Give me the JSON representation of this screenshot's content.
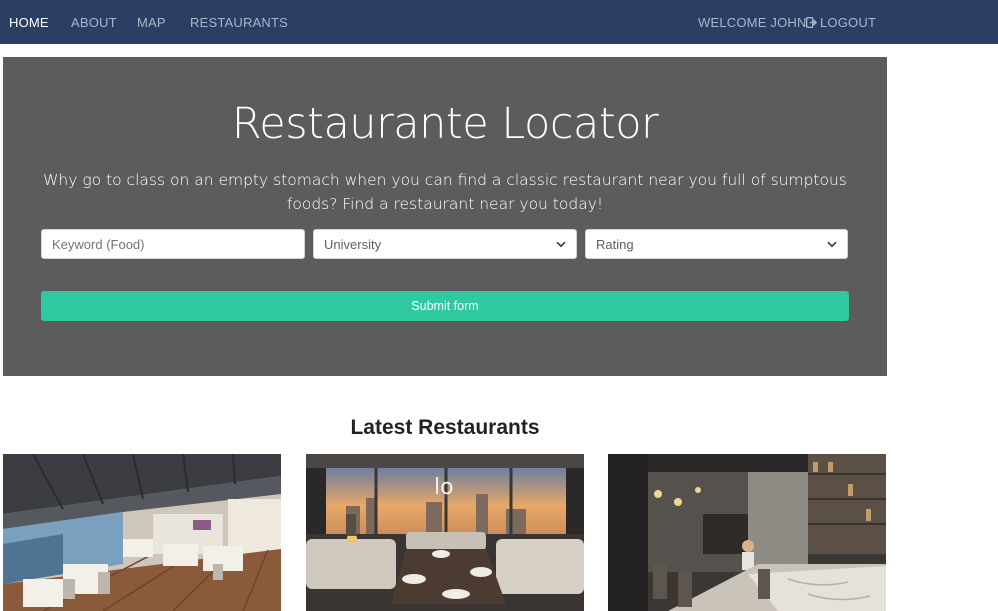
{
  "nav": {
    "home": "HOME",
    "about": "ABOUT",
    "map": "MAP",
    "restaurants": "RESTAURANTS",
    "welcome": "WELCOME JOHN",
    "logout": "LOGOUT",
    "logout_icon": "sign-out-icon"
  },
  "hero": {
    "title": "Restaurante Locator",
    "text": "Why go to class on an empty stomach when you can find a classic restaurant near you full of sumptous foods? Find a restaurant near you today!",
    "keyword_placeholder": "Keyword (Food)",
    "university_selected": "University",
    "rating_selected": "Rating",
    "submit_label": "Submit form"
  },
  "latest": {
    "title": "Latest Restaurants",
    "cards": [
      {
        "image": "restaurant-terrace-photo"
      },
      {
        "image": "restaurant-lounge-photo"
      },
      {
        "image": "restaurant-kitchen-photo"
      }
    ]
  },
  "colors": {
    "navbar": "#2b3e63",
    "hero": "#5c5c5c",
    "submit": "#2ec99e"
  }
}
